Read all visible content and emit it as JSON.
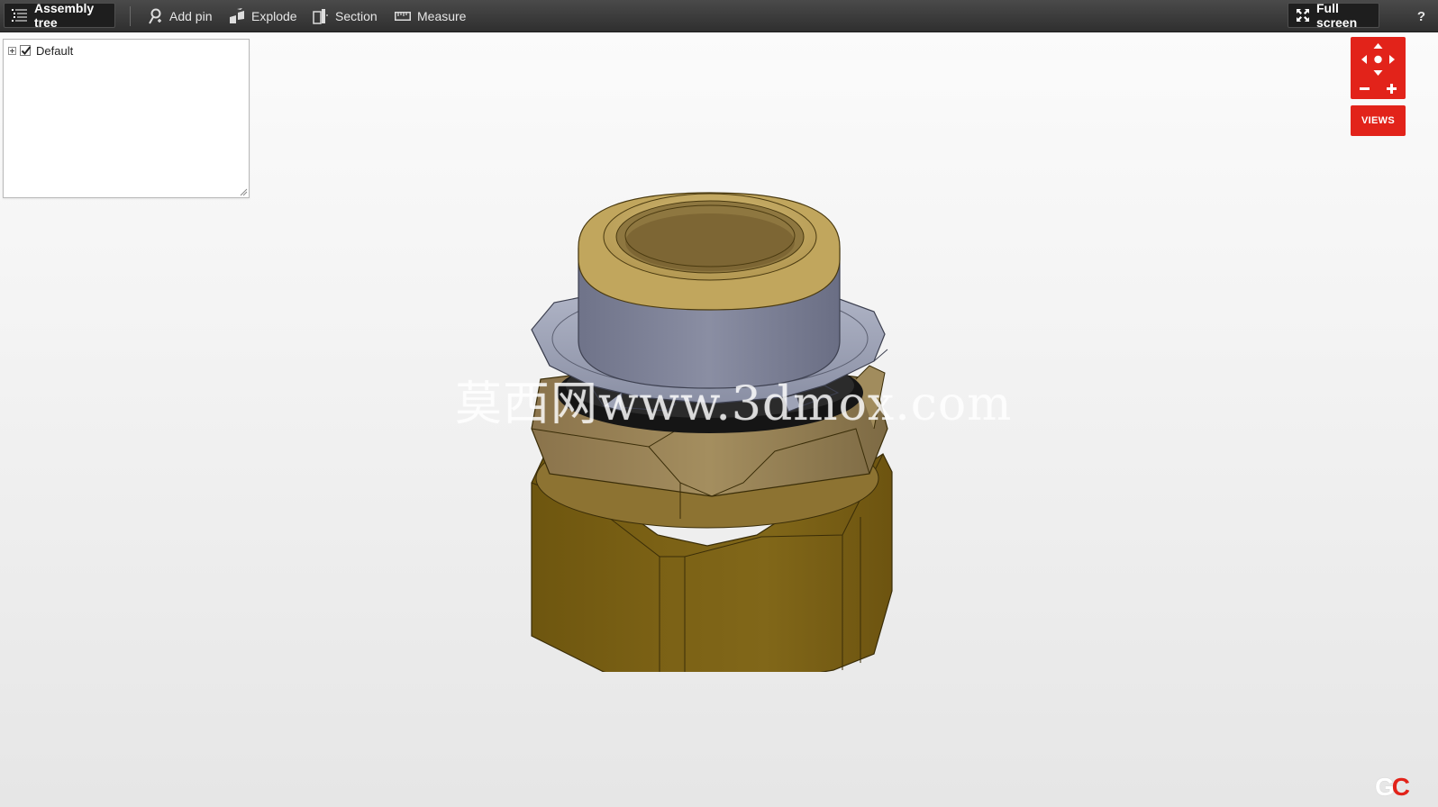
{
  "toolbar": {
    "assembly_tree_label": "Assembly tree",
    "add_pin_label": "Add pin",
    "explode_label": "Explode",
    "section_label": "Section",
    "measure_label": "Measure",
    "full_screen_label": "Full screen",
    "help_label": "?"
  },
  "tree": {
    "items": [
      {
        "label": "Default",
        "checked": true,
        "expanded": false
      }
    ]
  },
  "nav": {
    "views_label": "VIEWS",
    "icons": [
      "pan-up-icon",
      "pan-down-icon",
      "pan-left-icon",
      "pan-right-icon",
      "orbit-center-icon",
      "zoom-out-icon",
      "zoom-in-icon"
    ]
  },
  "viewport": {
    "watermark_text": "莫西网www.3dmox.com",
    "logo_text_1": "G",
    "logo_text_2": "C"
  },
  "colors": {
    "toolbar_bg": "#3a3a3a",
    "accent_red": "#e2231a",
    "brass_dark": "#7a6116",
    "brass_light": "#c2a75e",
    "steel": "#8e93a8"
  }
}
